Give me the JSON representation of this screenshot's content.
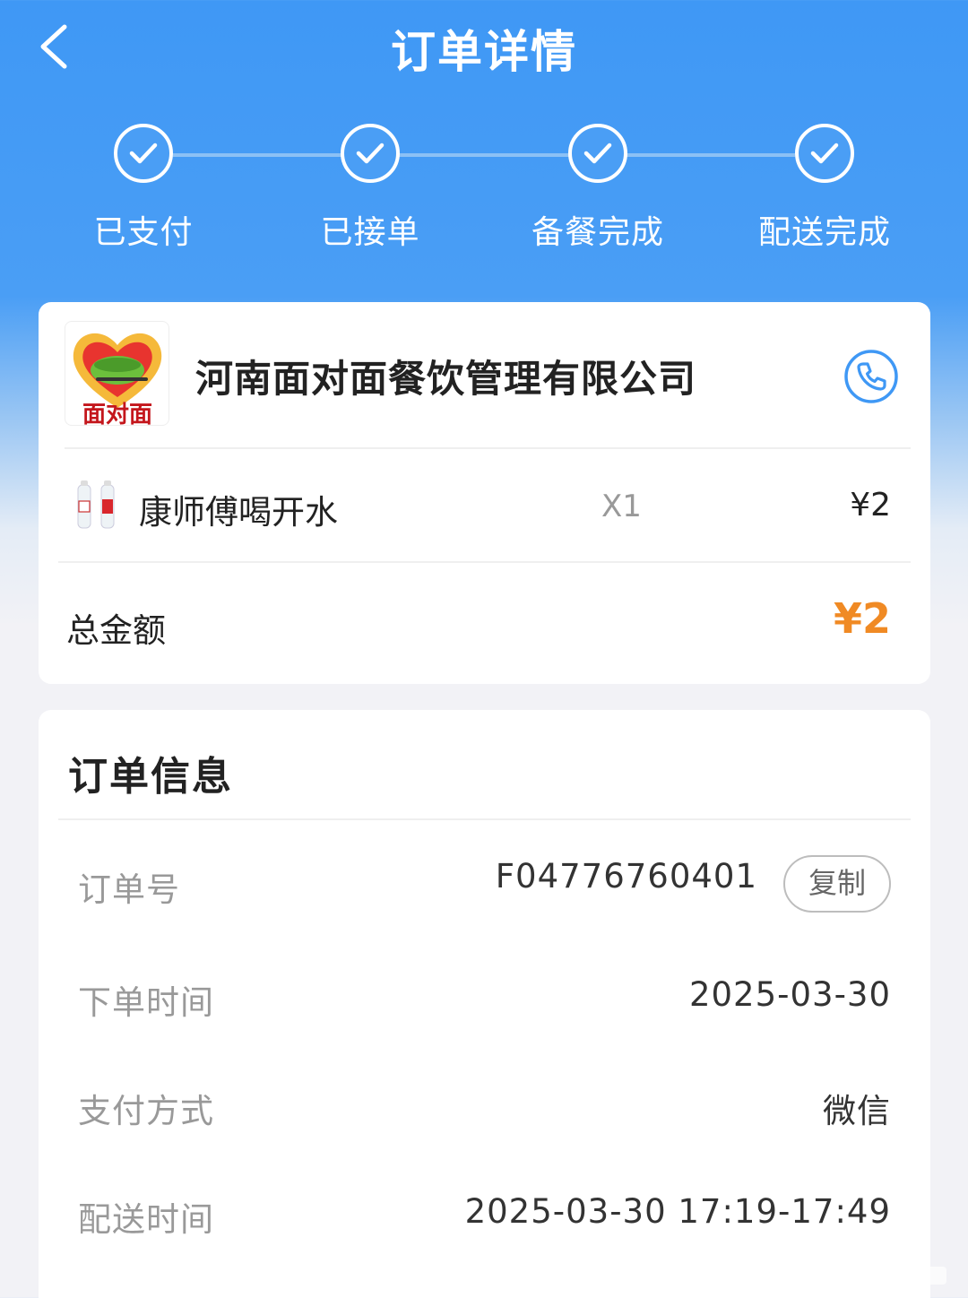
{
  "header": {
    "title": "订单详情"
  },
  "steps": [
    {
      "label": "已支付"
    },
    {
      "label": "已接单"
    },
    {
      "label": "备餐完成"
    },
    {
      "label": "配送完成"
    }
  ],
  "shop": {
    "name": "河南面对面餐饮管理有限公司",
    "logo_text": "面对面"
  },
  "item": {
    "name": "康师傅喝开水",
    "qty": "X1",
    "price": "¥2"
  },
  "total": {
    "label": "总金额",
    "value": "¥2"
  },
  "order_info": {
    "title": "订单信息",
    "rows": [
      {
        "label": "订单号",
        "value": "F04776760401"
      },
      {
        "label": "下单时间",
        "value": "2025-03-30"
      },
      {
        "label": "支付方式",
        "value": "微信"
      },
      {
        "label": "配送时间",
        "value": "2025-03-30 17:19-17:49"
      }
    ],
    "copy_label": "复制"
  },
  "colors": {
    "primary": "#3f98f5",
    "accent": "#f08a24"
  },
  "icons": [
    "chevron-left-icon",
    "check-circle-icon",
    "phone-icon",
    "bottle-icon"
  ]
}
